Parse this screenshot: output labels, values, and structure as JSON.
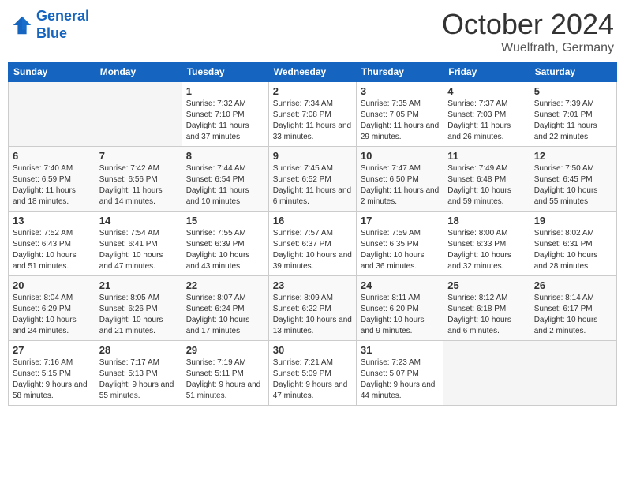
{
  "header": {
    "logo_line1": "General",
    "logo_line2": "Blue",
    "month": "October 2024",
    "location": "Wuelfrath, Germany"
  },
  "days_of_week": [
    "Sunday",
    "Monday",
    "Tuesday",
    "Wednesday",
    "Thursday",
    "Friday",
    "Saturday"
  ],
  "weeks": [
    [
      {
        "day": "",
        "info": ""
      },
      {
        "day": "",
        "info": ""
      },
      {
        "day": "1",
        "info": "Sunrise: 7:32 AM\nSunset: 7:10 PM\nDaylight: 11 hours and 37 minutes."
      },
      {
        "day": "2",
        "info": "Sunrise: 7:34 AM\nSunset: 7:08 PM\nDaylight: 11 hours and 33 minutes."
      },
      {
        "day": "3",
        "info": "Sunrise: 7:35 AM\nSunset: 7:05 PM\nDaylight: 11 hours and 29 minutes."
      },
      {
        "day": "4",
        "info": "Sunrise: 7:37 AM\nSunset: 7:03 PM\nDaylight: 11 hours and 26 minutes."
      },
      {
        "day": "5",
        "info": "Sunrise: 7:39 AM\nSunset: 7:01 PM\nDaylight: 11 hours and 22 minutes."
      }
    ],
    [
      {
        "day": "6",
        "info": "Sunrise: 7:40 AM\nSunset: 6:59 PM\nDaylight: 11 hours and 18 minutes."
      },
      {
        "day": "7",
        "info": "Sunrise: 7:42 AM\nSunset: 6:56 PM\nDaylight: 11 hours and 14 minutes."
      },
      {
        "day": "8",
        "info": "Sunrise: 7:44 AM\nSunset: 6:54 PM\nDaylight: 11 hours and 10 minutes."
      },
      {
        "day": "9",
        "info": "Sunrise: 7:45 AM\nSunset: 6:52 PM\nDaylight: 11 hours and 6 minutes."
      },
      {
        "day": "10",
        "info": "Sunrise: 7:47 AM\nSunset: 6:50 PM\nDaylight: 11 hours and 2 minutes."
      },
      {
        "day": "11",
        "info": "Sunrise: 7:49 AM\nSunset: 6:48 PM\nDaylight: 10 hours and 59 minutes."
      },
      {
        "day": "12",
        "info": "Sunrise: 7:50 AM\nSunset: 6:45 PM\nDaylight: 10 hours and 55 minutes."
      }
    ],
    [
      {
        "day": "13",
        "info": "Sunrise: 7:52 AM\nSunset: 6:43 PM\nDaylight: 10 hours and 51 minutes."
      },
      {
        "day": "14",
        "info": "Sunrise: 7:54 AM\nSunset: 6:41 PM\nDaylight: 10 hours and 47 minutes."
      },
      {
        "day": "15",
        "info": "Sunrise: 7:55 AM\nSunset: 6:39 PM\nDaylight: 10 hours and 43 minutes."
      },
      {
        "day": "16",
        "info": "Sunrise: 7:57 AM\nSunset: 6:37 PM\nDaylight: 10 hours and 39 minutes."
      },
      {
        "day": "17",
        "info": "Sunrise: 7:59 AM\nSunset: 6:35 PM\nDaylight: 10 hours and 36 minutes."
      },
      {
        "day": "18",
        "info": "Sunrise: 8:00 AM\nSunset: 6:33 PM\nDaylight: 10 hours and 32 minutes."
      },
      {
        "day": "19",
        "info": "Sunrise: 8:02 AM\nSunset: 6:31 PM\nDaylight: 10 hours and 28 minutes."
      }
    ],
    [
      {
        "day": "20",
        "info": "Sunrise: 8:04 AM\nSunset: 6:29 PM\nDaylight: 10 hours and 24 minutes."
      },
      {
        "day": "21",
        "info": "Sunrise: 8:05 AM\nSunset: 6:26 PM\nDaylight: 10 hours and 21 minutes."
      },
      {
        "day": "22",
        "info": "Sunrise: 8:07 AM\nSunset: 6:24 PM\nDaylight: 10 hours and 17 minutes."
      },
      {
        "day": "23",
        "info": "Sunrise: 8:09 AM\nSunset: 6:22 PM\nDaylight: 10 hours and 13 minutes."
      },
      {
        "day": "24",
        "info": "Sunrise: 8:11 AM\nSunset: 6:20 PM\nDaylight: 10 hours and 9 minutes."
      },
      {
        "day": "25",
        "info": "Sunrise: 8:12 AM\nSunset: 6:18 PM\nDaylight: 10 hours and 6 minutes."
      },
      {
        "day": "26",
        "info": "Sunrise: 8:14 AM\nSunset: 6:17 PM\nDaylight: 10 hours and 2 minutes."
      }
    ],
    [
      {
        "day": "27",
        "info": "Sunrise: 7:16 AM\nSunset: 5:15 PM\nDaylight: 9 hours and 58 minutes."
      },
      {
        "day": "28",
        "info": "Sunrise: 7:17 AM\nSunset: 5:13 PM\nDaylight: 9 hours and 55 minutes."
      },
      {
        "day": "29",
        "info": "Sunrise: 7:19 AM\nSunset: 5:11 PM\nDaylight: 9 hours and 51 minutes."
      },
      {
        "day": "30",
        "info": "Sunrise: 7:21 AM\nSunset: 5:09 PM\nDaylight: 9 hours and 47 minutes."
      },
      {
        "day": "31",
        "info": "Sunrise: 7:23 AM\nSunset: 5:07 PM\nDaylight: 9 hours and 44 minutes."
      },
      {
        "day": "",
        "info": ""
      },
      {
        "day": "",
        "info": ""
      }
    ]
  ]
}
